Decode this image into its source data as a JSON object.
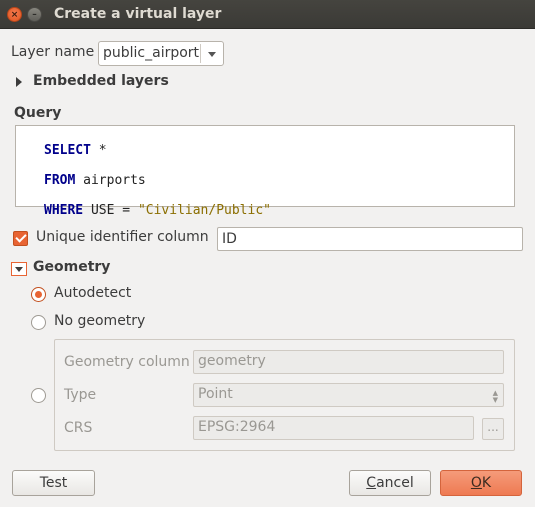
{
  "window": {
    "title": "Create a virtual layer",
    "close_glyph": "×",
    "minimize_glyph": "–"
  },
  "layer_name": {
    "label": "Layer name",
    "value": "public_airports"
  },
  "embedded_layers": {
    "label": "Embedded layers"
  },
  "query": {
    "label": "Query",
    "lines": [
      {
        "keyword": "SELECT",
        "rest": " *"
      },
      {
        "keyword": "FROM",
        "rest": " airports"
      },
      {
        "keyword": "WHERE",
        "rest": " USE = ",
        "string": "\"Civilian/Public\""
      }
    ]
  },
  "unique_id": {
    "label": "Unique identifier column",
    "checked": true,
    "value": "ID"
  },
  "geometry": {
    "label": "Geometry",
    "autodetect_label": "Autodetect",
    "no_geometry_label": "No geometry",
    "selected": "autodetect",
    "column_label": "Geometry column",
    "column_value": "geometry",
    "type_label": "Type",
    "type_value": "Point",
    "crs_label": "CRS",
    "crs_value": "EPSG:2964",
    "crs_button_label": "..."
  },
  "buttons": {
    "test": "Test",
    "cancel_first": "C",
    "cancel_rest": "ancel",
    "ok_first": "O",
    "ok_rest": "K"
  },
  "colors": {
    "accent": "#e86433",
    "titlebar": "#3c3b37",
    "background": "#f2f1f0"
  }
}
